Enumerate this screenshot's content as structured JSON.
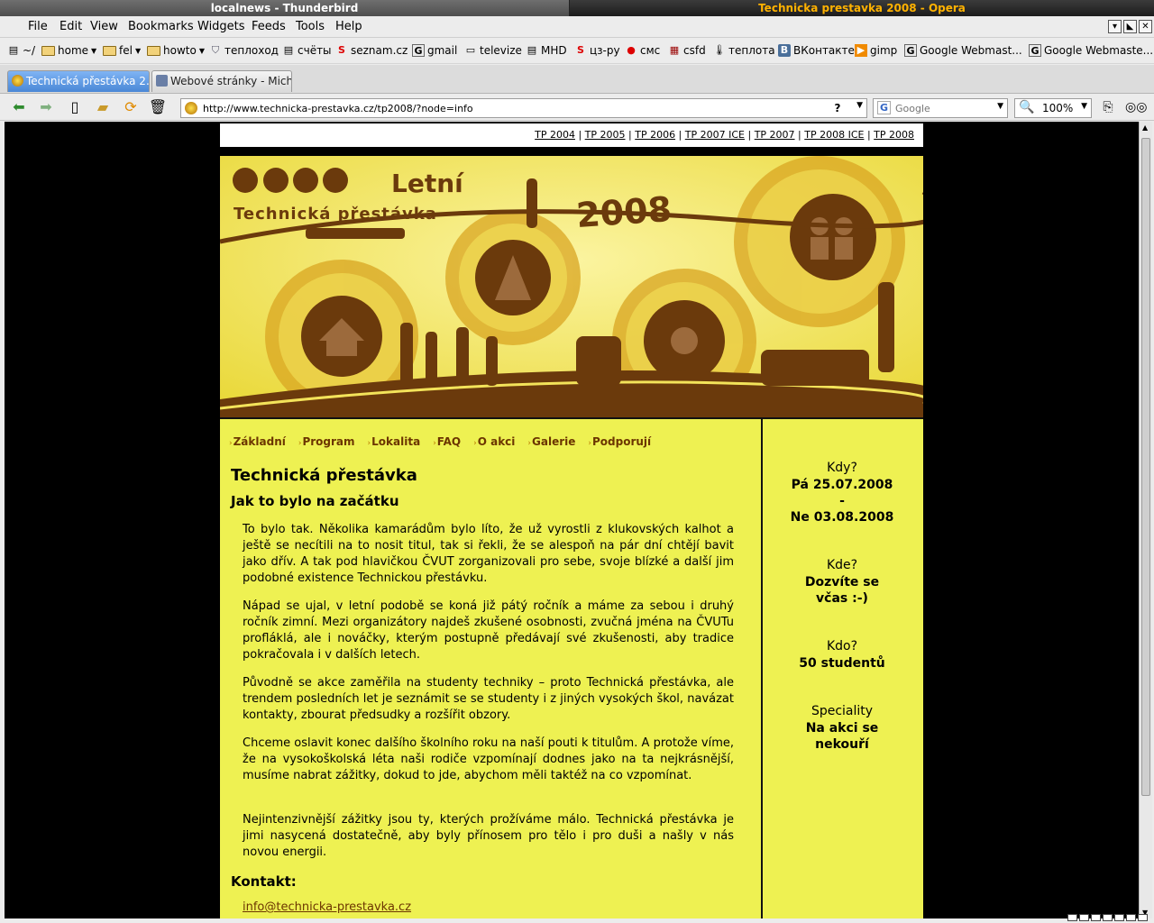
{
  "titlebars": {
    "left": "localnews - Thunderbird",
    "right": "Technicka prestavka 2008 - Opera"
  },
  "menu": [
    "File",
    "Edit",
    "View",
    "Bookmarks",
    "Widgets",
    "Feeds",
    "Tools",
    "Help"
  ],
  "bookmarks": [
    "~/",
    "home",
    "fel",
    "howto",
    "теплоход",
    "счёты",
    "seznam.cz",
    "gmail",
    "televize",
    "MHD",
    "цз-ру",
    "смс",
    "csfd",
    "теплота",
    "ВКонтакте",
    "gimp",
    "Google Webmast...",
    "Google Webmaste..."
  ],
  "tabs": [
    "Technická přestávka 2...",
    "Webové stránky - Mich..."
  ],
  "nav": {
    "url": "http://www.technicka-prestavka.cz/tp2008/?node=info",
    "search_placeholder": "Google",
    "zoom": "100%"
  },
  "page": {
    "top_links": [
      "TP 2004",
      "TP 2005",
      "TP 2006",
      "TP 2007 ICE",
      "TP 2007",
      "TP 2008 ICE",
      "TP 2008"
    ],
    "banner": {
      "letni": "Letní",
      "technicka": "Technická přestávka",
      "year": "2008"
    },
    "nav": [
      "Základní",
      "Program",
      "Lokalita",
      "FAQ",
      "O akci",
      "Galerie",
      "Podporují"
    ],
    "title": "Technická přestávka",
    "subtitle": "Jak to bylo na začátku",
    "paragraphs": [
      "To bylo tak. Několika kamarádům bylo líto, že už vyrostli z klukovských kalhot a ještě se necítili na to nosit titul, tak si řekli, že se alespoň na pár dní chtějí bavit jako dřív. A tak pod hlavičkou ČVUT zorganizovali pro sebe, svoje blízké a další jim podobné existence Technickou přestávku.",
      "Nápad se ujal, v letní podobě se koná již pátý ročník a máme za sebou i druhý ročník zimní. Mezi organizátory najdeš zkušené osobnosti, zvučná jména na ČVUTu profláklá, ale i nováčky, kterým postupně předávají své zkušenosti, aby tradice pokračovala i v dalších letech.",
      "Původně se akce zaměřila na studenty techniky – proto Technická přestávka, ale trendem posledních let je seznámit se se studenty i z jiných vysokých škol, navázat kontakty, zbourat předsudky a rozšířit obzory.",
      "Chceme oslavit konec dalšího školního roku na naší pouti k titulům. A protože víme, že na vysokoškolská léta naši rodiče vzpomínají dodnes jako na ta nejkrásnější, musíme nabrat zážitky, dokud to jde, abychom měli taktéž na co vzpomínat.",
      "Nejintenzivnější zážitky jsou ty, kterých prožíváme málo. Technická přestávka je jimi nasycená dostatečně, aby byly přínosem pro tělo i pro duši a našly v nás novou energii."
    ],
    "contact_heading": "Kontakt:",
    "email": "info@technicka-prestavka.cz",
    "sidebar": {
      "kdy_label": "Kdy?",
      "kdy_from": "Pá 25.07.2008",
      "kdy_sep": "-",
      "kdy_to": "Ne 03.08.2008",
      "kde_label": "Kde?",
      "kde_val1": "Dozvíte se",
      "kde_val2": "včas :-)",
      "kdo_label": "Kdo?",
      "kdo_val": "50 studentů",
      "spec_label": "Speciality",
      "spec_val1": "Na akci se",
      "spec_val2": "nekouří"
    }
  },
  "colors": {
    "banner_yellow": "#f0e244",
    "content_yellow": "#eef152",
    "brown": "#6b3500",
    "opera_title": "#ffb200"
  }
}
